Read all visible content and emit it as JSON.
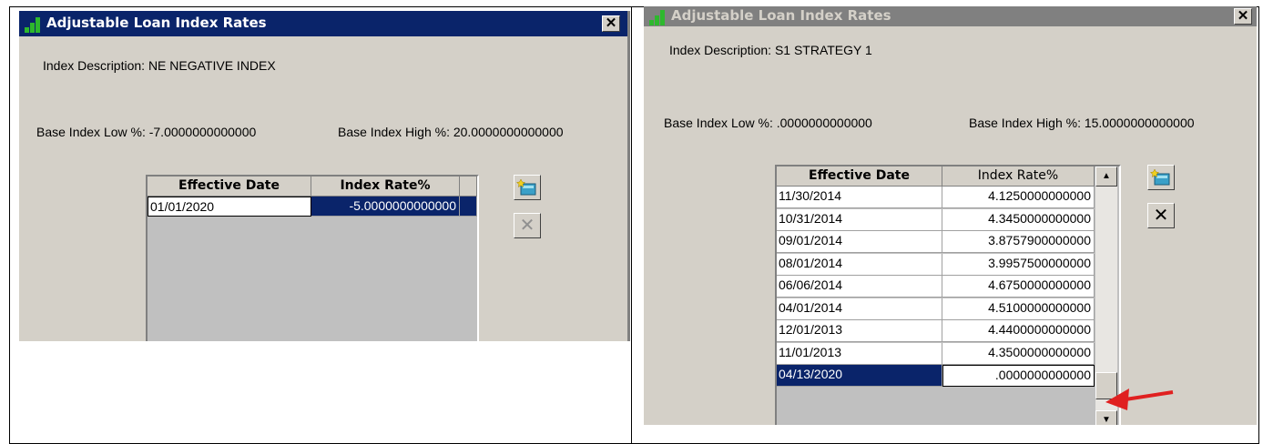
{
  "left_window": {
    "title": "Adjustable Loan Index Rates",
    "close_glyph": "✕",
    "index_description": "Index Description:  NE  NEGATIVE INDEX",
    "base_low": "Base Index Low %:  -7.0000000000000",
    "base_high": "Base Index High %: 20.0000000000000",
    "columns": [
      "Effective Date",
      "Index Rate%"
    ],
    "rows": [
      {
        "date": "01/01/2020",
        "rate": "-5.0000000000000"
      }
    ],
    "buttons": {
      "add_icon": "add-record-icon",
      "delete_glyph": "✕"
    }
  },
  "right_window": {
    "title": "Adjustable Loan Index Rates",
    "close_glyph": "✕",
    "index_description": "Index Description:  S1  STRATEGY 1",
    "base_low": "Base Index Low %:  .0000000000000",
    "base_high": "Base Index High %: 15.0000000000000",
    "columns": [
      "Effective Date",
      "Index Rate%"
    ],
    "rows": [
      {
        "date": "11/30/2014",
        "rate": "4.1250000000000"
      },
      {
        "date": "10/31/2014",
        "rate": "4.3450000000000"
      },
      {
        "date": "09/01/2014",
        "rate": "3.8757900000000"
      },
      {
        "date": "08/01/2014",
        "rate": "3.9957500000000"
      },
      {
        "date": "06/06/2014",
        "rate": "4.6750000000000"
      },
      {
        "date": "04/01/2014",
        "rate": "4.5100000000000"
      },
      {
        "date": "12/01/2013",
        "rate": "4.4400000000000"
      },
      {
        "date": "11/01/2013",
        "rate": "4.3500000000000"
      },
      {
        "date": "04/13/2020",
        "rate": ".0000000000000"
      }
    ],
    "scroll_up": "▲",
    "scroll_down": "▼",
    "buttons": {
      "add_icon": "add-record-icon",
      "delete_glyph": "✕"
    }
  },
  "colors": {
    "title_active": "#0a246a",
    "title_inactive": "#808080",
    "arrow": "#e02020"
  }
}
